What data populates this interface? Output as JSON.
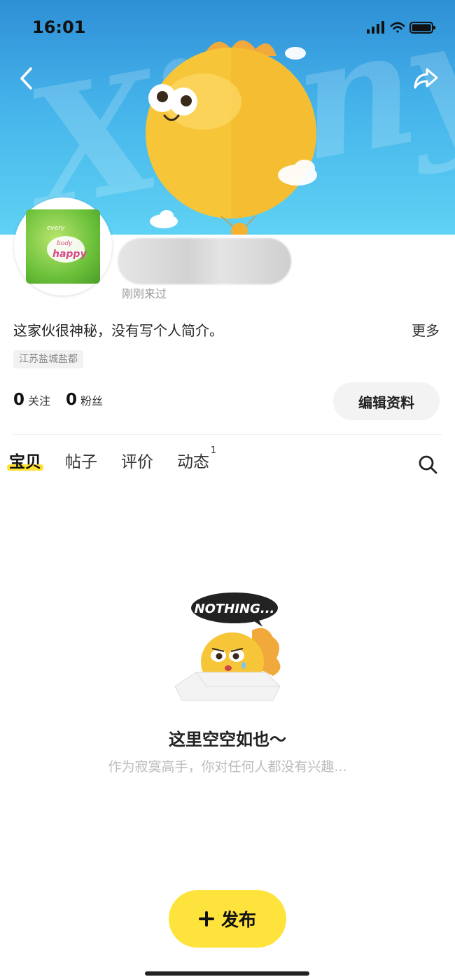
{
  "status_bar": {
    "time": "16:01"
  },
  "banner": {
    "watermark": "Xianyu"
  },
  "profile": {
    "last_seen": "刚刚来过",
    "bio": "这家伙很神秘，没有写个人简介。",
    "more_label": "更多",
    "location": "江苏盐城盐都",
    "following_count": "0",
    "following_label": "关注",
    "followers_count": "0",
    "followers_label": "粉丝",
    "edit_label": "编辑资料",
    "avatar_text": [
      "every",
      "body",
      "happy"
    ]
  },
  "tabs": [
    {
      "label": "宝贝",
      "active": true
    },
    {
      "label": "帖子"
    },
    {
      "label": "评价"
    },
    {
      "label": "动态",
      "badge": "1"
    }
  ],
  "empty_state": {
    "bubble_text": "NOTHING...",
    "title": "这里空空如也～",
    "subtitle": "作为寂寞高手，你对任何人都没有兴趣..."
  },
  "publish_button": {
    "icon": "plus-icon",
    "label": "发布"
  },
  "colors": {
    "accent": "#ffe33d",
    "banner_top": "#2e8fd6",
    "banner_bottom": "#5fd2f4"
  }
}
